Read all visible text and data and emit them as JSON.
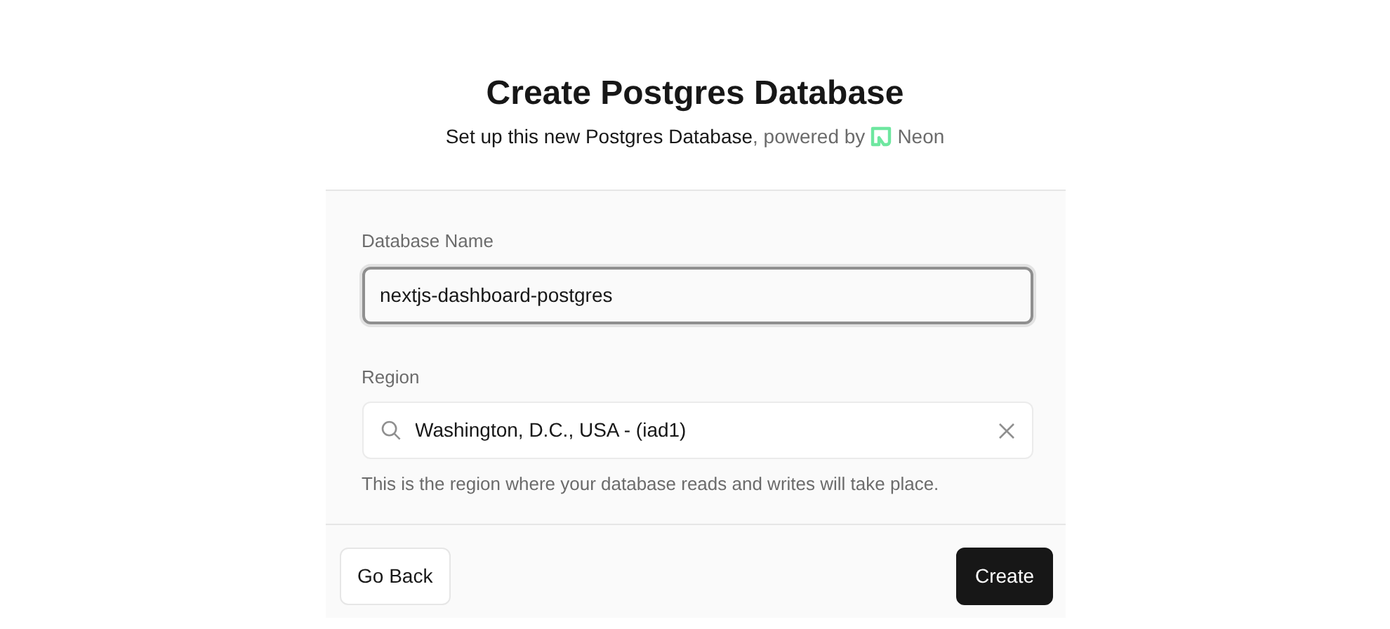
{
  "title": "Create Postgres Database",
  "subtitle": {
    "lead": "Set up this new Postgres Database",
    "tail": ", powered by",
    "brand": "Neon"
  },
  "fields": [
    {
      "kind": "text",
      "label": "Database Name",
      "value": "nextjs-dashboard-postgres",
      "focused": true
    },
    {
      "kind": "search",
      "label": "Region",
      "value": "Washington, D.C., USA - (iad1)",
      "help": "This is the region where your database reads and writes will take place.",
      "focused": false
    }
  ],
  "buttons": [
    {
      "label": "Go Back",
      "primary": false
    },
    {
      "label": "Create",
      "primary": true
    }
  ]
}
